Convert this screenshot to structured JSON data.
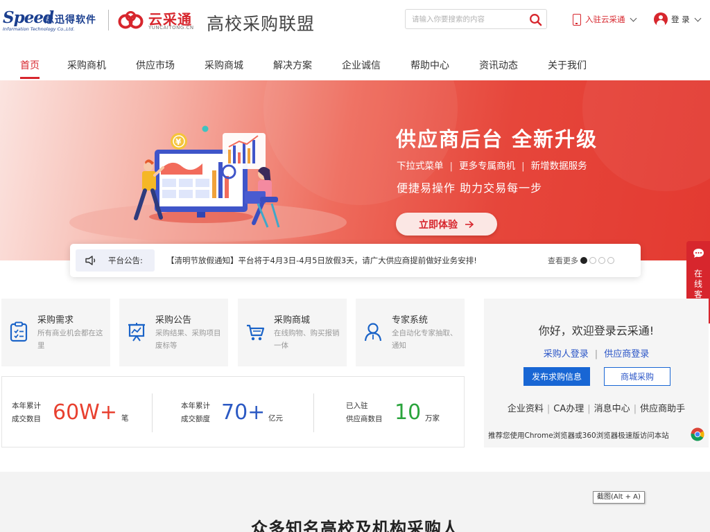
{
  "header": {
    "speed_logo_word": "Speed",
    "speed_logo_cn": "思迅得软件",
    "speed_logo_sub": "Information Technology Co.,Ltd.",
    "yct_logo_cn": "云采通",
    "yct_logo_en": "YUNCAITONG.CN",
    "alliance_title": "高校采购联盟",
    "search_placeholder": "请输入你要搜索的内容",
    "settle_label": "入驻云采通",
    "login_label": "登 录"
  },
  "nav": {
    "items": [
      {
        "label": "首页",
        "active": true
      },
      {
        "label": "采购商机"
      },
      {
        "label": "供应市场"
      },
      {
        "label": "采购商城"
      },
      {
        "label": "解决方案"
      },
      {
        "label": "企业诚信"
      },
      {
        "label": "帮助中心"
      },
      {
        "label": "资讯动态"
      },
      {
        "label": "关于我们"
      }
    ]
  },
  "banner": {
    "title": "供应商后台 全新升级",
    "features": [
      "下拉式菜单",
      "更多专属商机",
      "新增数据服务"
    ],
    "slogan": "便捷易操作  助力交易每一步",
    "cta_label": "立即体验"
  },
  "notice": {
    "tag": "平台公告:",
    "text": "【清明节放假通知】平台将于4月3日-4月5日放假3天，请广大供应商提前做好业务安排!",
    "more": "查看更多",
    "active_dot": 0,
    "dot_count": 4
  },
  "side_service": {
    "label": "在线客服"
  },
  "cards": [
    {
      "title": "采购需求",
      "desc": "所有商业机会都在这里",
      "icon": "clipboard-icon"
    },
    {
      "title": "采购公告",
      "desc": "采购结果、采购项目废标等",
      "icon": "presentation-icon"
    },
    {
      "title": "采购商城",
      "desc": "在线购物、购买报销一体",
      "icon": "cart-icon"
    },
    {
      "title": "专家系统",
      "desc": "全自动化专家抽取、通知",
      "icon": "person-icon"
    }
  ],
  "stats": [
    {
      "label_1": "本年累计",
      "label_2": "成交数目",
      "value": "60W+",
      "unit": "笔",
      "color": "#e8402f"
    },
    {
      "label_1": "本年累计",
      "label_2": "成交额度",
      "value": "70+",
      "unit": "亿元",
      "color": "#2b59c3"
    },
    {
      "label_1": "已入驻",
      "label_2": "供应商数目",
      "value": "10",
      "unit": "万家",
      "color": "#2aa43c"
    }
  ],
  "login_panel": {
    "welcome": "你好，欢迎登录云采通!",
    "buyer_login": "采购人登录",
    "supplier_login": "供应商登录",
    "publish_button": "发布求购信息",
    "mall_button": "商城采购",
    "quick_links": [
      "企业资料",
      "CA办理",
      "消息中心",
      "供应商助手"
    ],
    "recommend": "推荐您使用Chrome浏览器或360浏览器极速版访问本站"
  },
  "bottom": {
    "shortcut_tip": "截图(Alt + A)",
    "section_heading": "众多知名高校及机构采购人"
  },
  "colors": {
    "brand_red": "#d7262d",
    "link_blue": "#2a55c7",
    "button_blue": "#1866d4"
  }
}
